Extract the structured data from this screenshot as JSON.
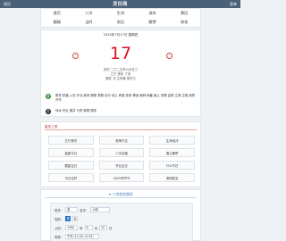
{
  "topbar": {
    "left": "首页",
    "title": "灵衍网",
    "right": "菜单"
  },
  "nav": {
    "items": [
      "首页",
      "八字",
      "生肖",
      "流年",
      "黄历",
      "姻缘",
      "吉时",
      "农历",
      "解梦",
      "穿衣"
    ]
  },
  "date": {
    "gregorian": "2025年7月17日 星期四",
    "day": "17",
    "prev_icon": "‹",
    "next_icon": "›",
    "lunar": [
      "农历 二〇二五年六月廿三",
      "乙巳 癸未 丁未",
      "属蛇 冲 生肖猪 煞东方"
    ],
    "yi_label": "宜",
    "yi": "祭祀 祈福 入宅 开业 纳采 嫁娶 求嗣 出行 动土 修造 安床 移徙 栽种 纳畜 破土 安葬 启攒 立券 交易 纳财 开市",
    "ji_label": "忌",
    "ji": "伐木 作灶 掘井 行丧 嫁娶 理发"
  },
  "tools": {
    "header": "星历工具",
    "items": [
      "五行穿衣",
      "财神方位",
      "生肖相冲",
      "星座今日",
      "八字合婚",
      "周公解梦",
      "藏星吉日",
      "开业吉日",
      "什么节日",
      "今日吉时",
      "2025年节气",
      "测测姓名"
    ]
  },
  "bazi": {
    "title": "八字综合测试",
    "icon": "✦",
    "name_label": "姓氏：",
    "surname": "张",
    "given_label": "名字：",
    "given": "小明",
    "gender_label": "性别：",
    "gender_options": [
      "男",
      "女"
    ],
    "birth_label": "公历：",
    "year": "1990",
    "year_unit": "年",
    "month": "6",
    "month_unit": "月",
    "day": "15",
    "day_unit": "日",
    "hour_label": "时辰：",
    "hour": "午时 (11:00-12:59)"
  },
  "colors": {
    "accent": "#2b6fc8",
    "red": "#d12",
    "topbar": "#4a6177"
  }
}
